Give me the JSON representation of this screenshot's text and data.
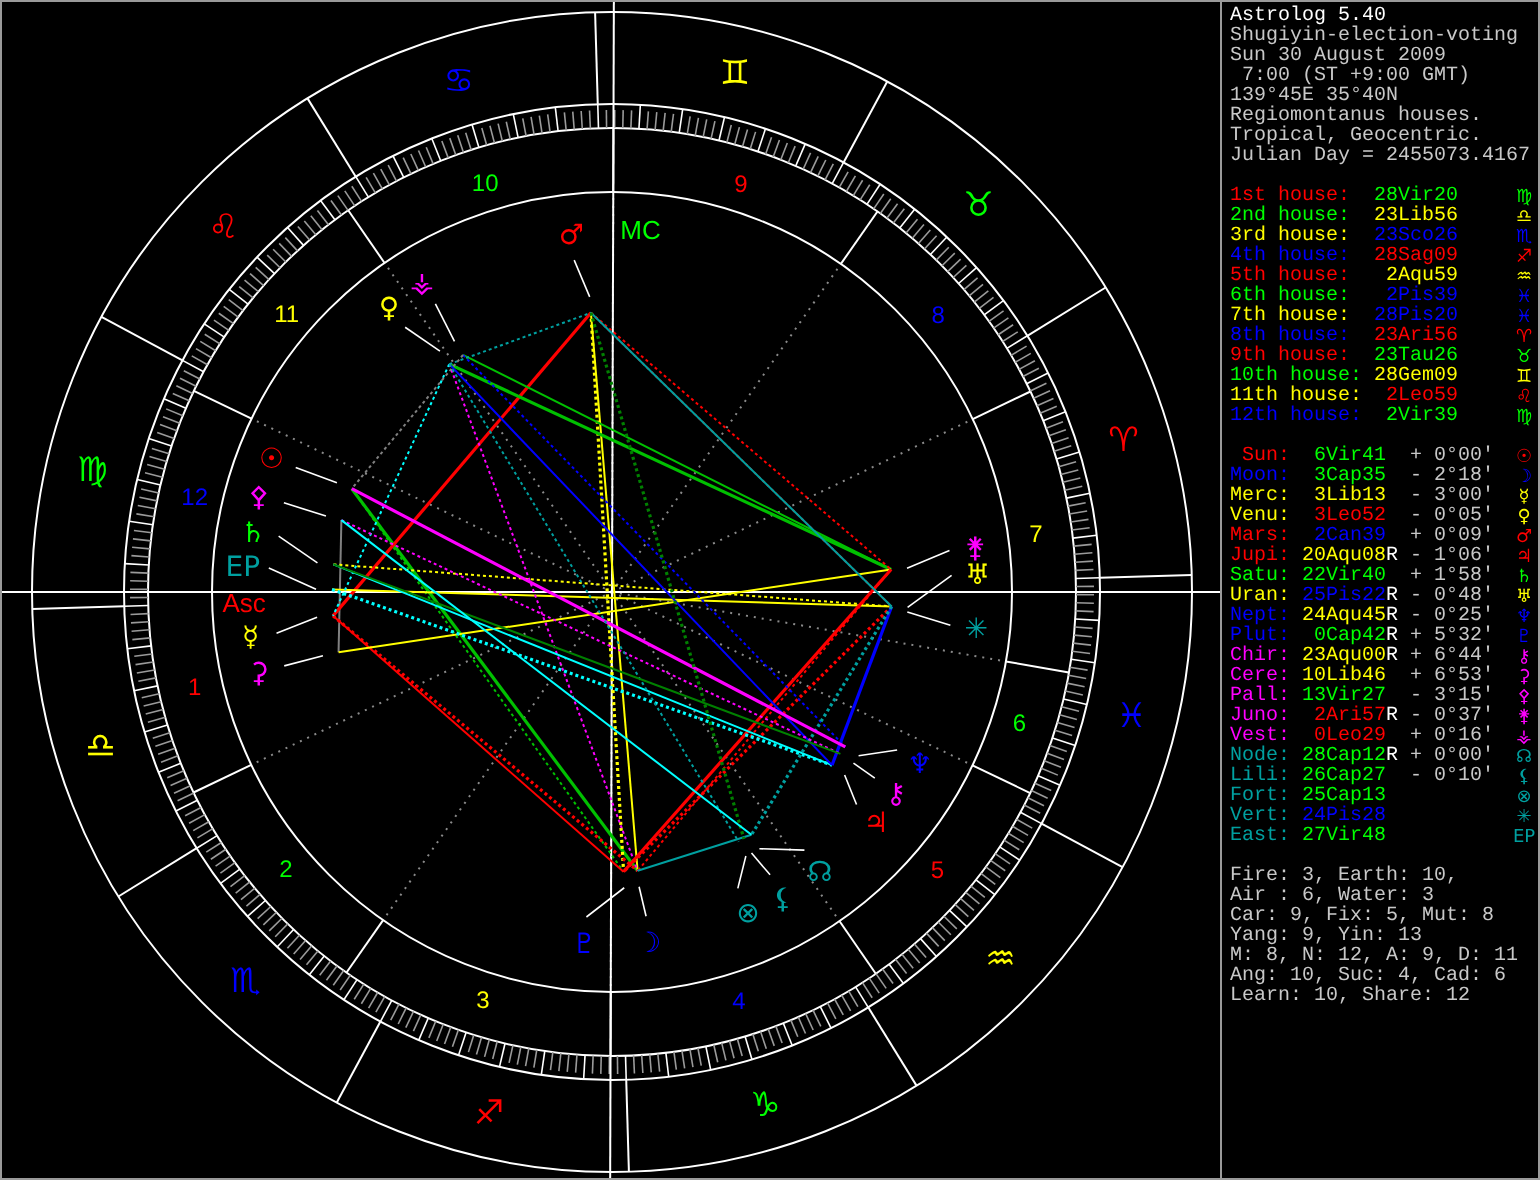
{
  "chart": {
    "signs": [
      {
        "glyph": "♈",
        "color": "#ff0000"
      },
      {
        "glyph": "♉",
        "color": "#00ff00"
      },
      {
        "glyph": "♊",
        "color": "#ffff00"
      },
      {
        "glyph": "♋",
        "color": "#0000ff"
      },
      {
        "glyph": "♌",
        "color": "#ff0000"
      },
      {
        "glyph": "♍",
        "color": "#00ff00"
      },
      {
        "glyph": "♎",
        "color": "#ffff00"
      },
      {
        "glyph": "♏",
        "color": "#0000ff"
      },
      {
        "glyph": "♐",
        "color": "#ff0000"
      },
      {
        "glyph": "♑",
        "color": "#00ff00"
      },
      {
        "glyph": "♒",
        "color": "#ffff00"
      },
      {
        "glyph": "♓",
        "color": "#0000ff"
      }
    ],
    "house_numbers": [
      {
        "label": "1",
        "color": "#ff0000"
      },
      {
        "label": "2",
        "color": "#00ff00"
      },
      {
        "label": "3",
        "color": "#ffff00"
      },
      {
        "label": "4",
        "color": "#0000ff"
      },
      {
        "label": "5",
        "color": "#ff0000"
      },
      {
        "label": "6",
        "color": "#00ff00"
      },
      {
        "label": "7",
        "color": "#ffff00"
      },
      {
        "label": "8",
        "color": "#0000ff"
      },
      {
        "label": "9",
        "color": "#ff0000"
      },
      {
        "label": "10",
        "color": "#00ff00"
      },
      {
        "label": "11",
        "color": "#ffff00"
      },
      {
        "label": "12",
        "color": "#0000ff"
      }
    ],
    "angles": [
      {
        "label": "MC",
        "color": "#00ff00"
      },
      {
        "label": "Asc",
        "color": "#ff0000"
      }
    ],
    "planets": [
      {
        "glyph": "☉",
        "color": "#ff0000"
      },
      {
        "glyph": "☽",
        "color": "#0000ff"
      },
      {
        "glyph": "☿",
        "color": "#ffff00"
      },
      {
        "glyph": "♀",
        "color": "#ffff00"
      },
      {
        "glyph": "♂",
        "color": "#ff0000"
      },
      {
        "glyph": "♃",
        "color": "#ff0000"
      },
      {
        "glyph": "♄",
        "color": "#00ff00"
      },
      {
        "glyph": "♅",
        "color": "#ffff00"
      },
      {
        "glyph": "♆",
        "color": "#0000ff"
      },
      {
        "glyph": "♇",
        "color": "#0000ff"
      },
      {
        "glyph": "⚷",
        "color": "#ff00ff"
      },
      {
        "glyph": "⚴",
        "color": "#ff00ff"
      },
      {
        "glyph": "⚳",
        "color": "#ff00ff"
      },
      {
        "glyph": "⚵",
        "color": "#ff00ff"
      },
      {
        "glyph": "⚶",
        "color": "#ff00ff"
      },
      {
        "glyph": "☊",
        "color": "#00a0a0"
      },
      {
        "glyph": "⚸",
        "color": "#00a0a0"
      },
      {
        "glyph": "⊗",
        "color": "#00a0a0"
      },
      {
        "glyph": "✳",
        "color": "#00a0a0"
      },
      {
        "glyph": "EP",
        "color": "#00a0a0"
      }
    ]
  },
  "info": {
    "title": "Astrolog 5.40",
    "lines": [
      "Shugiyin-election-voting",
      "Sun 30 August 2009",
      " 7:00 (ST +9:00 GMT)",
      "139°45E 35°40N",
      "Regiomontanus houses.",
      "Tropical, Geocentric.",
      "Julian Day = 2455073.4167"
    ]
  },
  "houses": [
    {
      "label": "1st house:",
      "color": "#ff0000",
      "position": {
        "value": "28Vir20",
        "color": "#00ff00"
      },
      "glyph": "♍"
    },
    {
      "label": "2nd house:",
      "color": "#00ff00",
      "position": {
        "value": "23Lib56",
        "color": "#ffff00"
      },
      "glyph": "♎"
    },
    {
      "label": "3rd house:",
      "color": "#ffff00",
      "position": {
        "value": "23Sco26",
        "color": "#0000ff"
      },
      "glyph": "♏"
    },
    {
      "label": "4th house:",
      "color": "#0000ff",
      "position": {
        "value": "28Sag09",
        "color": "#ff0000"
      },
      "glyph": "♐"
    },
    {
      "label": "5th house:",
      "color": "#ff0000",
      "position": {
        "value": "2Aqu59",
        "color": "#ffff00"
      },
      "glyph": "♒"
    },
    {
      "label": "6th house:",
      "color": "#00ff00",
      "position": {
        "value": "2Pis39",
        "color": "#0000ff"
      },
      "glyph": "♓"
    },
    {
      "label": "7th house:",
      "color": "#ffff00",
      "position": {
        "value": "28Pis20",
        "color": "#0000ff"
      },
      "glyph": "♓"
    },
    {
      "label": "8th house:",
      "color": "#0000ff",
      "position": {
        "value": "23Ari56",
        "color": "#ff0000"
      },
      "glyph": "♈"
    },
    {
      "label": "9th house:",
      "color": "#ff0000",
      "position": {
        "value": "23Tau26",
        "color": "#00ff00"
      },
      "glyph": "♉"
    },
    {
      "label": "10th house:",
      "color": "#00ff00",
      "position": {
        "value": "28Gem09",
        "color": "#ffff00"
      },
      "glyph": "♊"
    },
    {
      "label": "11th house:",
      "color": "#ffff00",
      "position": {
        "value": "2Leo59",
        "color": "#ff0000"
      },
      "glyph": "♌"
    },
    {
      "label": "12th house:",
      "color": "#0000ff",
      "position": {
        "value": "2Vir39",
        "color": "#00ff00"
      },
      "glyph": "♍"
    }
  ],
  "planets": [
    {
      "name": "Sun:",
      "color": "#ff0000",
      "position": {
        "value": "6Vir41",
        "color": "#00ff00"
      },
      "latitude": "+ 0°00'",
      "glyph": "☉"
    },
    {
      "name": "Moon:",
      "color": "#0000ff",
      "position": {
        "value": "3Cap35",
        "color": "#00ff00"
      },
      "latitude": "- 2°18'",
      "glyph": "☽"
    },
    {
      "name": "Merc:",
      "color": "#ffff00",
      "position": {
        "value": "3Lib13",
        "color": "#ffff00"
      },
      "latitude": "- 3°00'",
      "glyph": "☿"
    },
    {
      "name": "Venu:",
      "color": "#ffff00",
      "position": {
        "value": "3Leo52",
        "color": "#ff0000"
      },
      "latitude": "- 0°05'",
      "glyph": "♀"
    },
    {
      "name": "Mars:",
      "color": "#ff0000",
      "position": {
        "value": "2Can39",
        "color": "#0000ff"
      },
      "latitude": "+ 0°09'",
      "glyph": "♂"
    },
    {
      "name": "Jupi:",
      "color": "#ff0000",
      "position": {
        "value": "20Aqu08",
        "color": "#ffff00"
      },
      "motion": "R",
      "latitude": "- 1°06'",
      "glyph": "♃"
    },
    {
      "name": "Satu:",
      "color": "#00ff00",
      "position": {
        "value": "22Vir40",
        "color": "#00ff00"
      },
      "latitude": "+ 1°58'",
      "glyph": "♄"
    },
    {
      "name": "Uran:",
      "color": "#ffff00",
      "position": {
        "value": "25Pis22",
        "color": "#0000ff"
      },
      "motion": "R",
      "latitude": "- 0°48'",
      "glyph": "♅"
    },
    {
      "name": "Nept:",
      "color": "#0000ff",
      "position": {
        "value": "24Aqu45",
        "color": "#ffff00"
      },
      "motion": "R",
      "latitude": "- 0°25'",
      "glyph": "♆"
    },
    {
      "name": "Plut:",
      "color": "#0000ff",
      "position": {
        "value": "0Cap42",
        "color": "#00ff00"
      },
      "motion": "R",
      "latitude": "+ 5°32'",
      "glyph": "♇"
    },
    {
      "name": "Chir:",
      "color": "#ff00ff",
      "position": {
        "value": "23Aqu00",
        "color": "#ffff00"
      },
      "motion": "R",
      "latitude": "+ 6°44'",
      "glyph": "⚷"
    },
    {
      "name": "Cere:",
      "color": "#ff00ff",
      "position": {
        "value": "10Lib46",
        "color": "#ffff00"
      },
      "latitude": "+ 6°53'",
      "glyph": "⚳"
    },
    {
      "name": "Pall:",
      "color": "#ff00ff",
      "position": {
        "value": "13Vir27",
        "color": "#00ff00"
      },
      "latitude": "- 3°15'",
      "glyph": "⚴"
    },
    {
      "name": "Juno:",
      "color": "#ff00ff",
      "position": {
        "value": "2Ari57",
        "color": "#ff0000"
      },
      "motion": "R",
      "latitude": "- 0°37'",
      "glyph": "⚵"
    },
    {
      "name": "Vest:",
      "color": "#ff00ff",
      "position": {
        "value": "0Leo29",
        "color": "#ff0000"
      },
      "latitude": "+ 0°16'",
      "glyph": "⚶"
    },
    {
      "name": "Node:",
      "color": "#00a0a0",
      "position": {
        "value": "28Cap12",
        "color": "#00ff00"
      },
      "motion": "R",
      "latitude": "+ 0°00'",
      "glyph": "☊"
    },
    {
      "name": "Lili:",
      "color": "#00a0a0",
      "position": {
        "value": "26Cap27",
        "color": "#00ff00"
      },
      "latitude": "- 0°10'",
      "glyph": "⚸"
    },
    {
      "name": "Fort:",
      "color": "#00a0a0",
      "position": {
        "value": "25Cap13",
        "color": "#00ff00"
      },
      "glyph": "⊗"
    },
    {
      "name": "Vert:",
      "color": "#00a0a0",
      "position": {
        "value": "24Pis28",
        "color": "#0000ff"
      },
      "glyph": "✳"
    },
    {
      "name": "East:",
      "color": "#00a0a0",
      "position": {
        "value": "27Vir48",
        "color": "#00ff00"
      },
      "glyph": "EP"
    }
  ],
  "summary": [
    "Fire: 3, Earth: 10,",
    "Air : 6, Water: 3",
    "Car: 9, Fix: 5, Mut: 8",
    "Yang: 9, Yin: 13",
    "M: 8, N: 12, A: 9, D: 11",
    "Ang: 10, Suc: 4, Cad: 6",
    "Learn: 10, Share: 12"
  ]
}
